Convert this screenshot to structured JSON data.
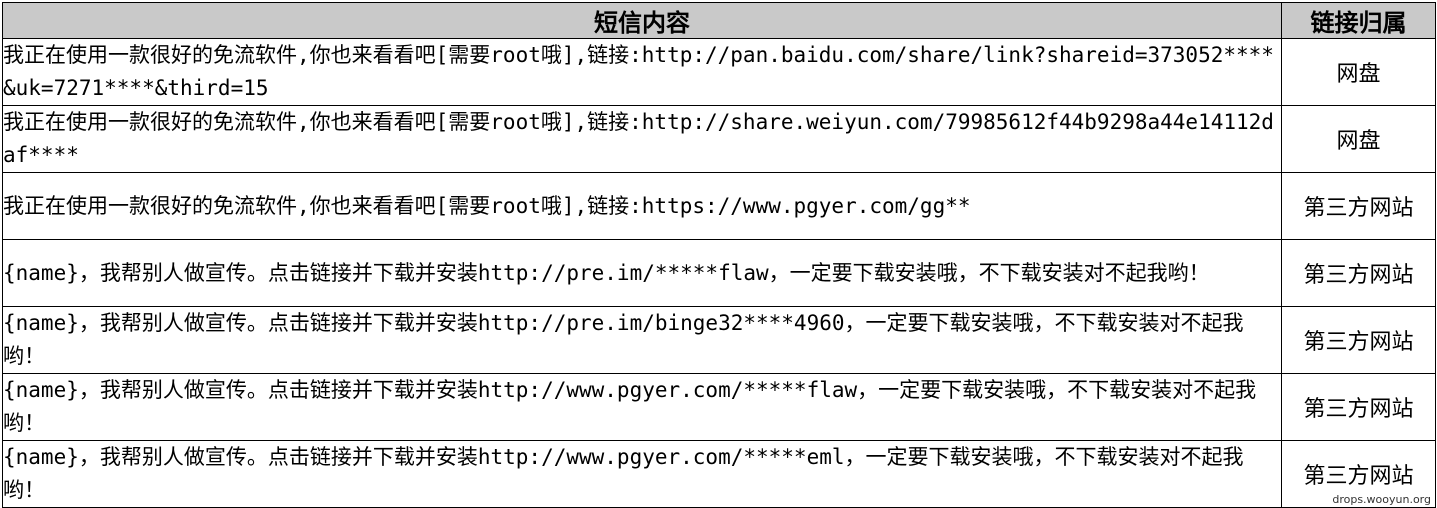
{
  "table": {
    "headers": {
      "content": "短信内容",
      "source": "链接归属"
    },
    "rows": [
      {
        "content": "我正在使用一款很好的免流软件,你也来看看吧[需要root哦],链接:http://pan.baidu.com/share/link?shareid=373052****&uk=7271****&third=15",
        "source": "网盘"
      },
      {
        "content": "我正在使用一款很好的免流软件,你也来看看吧[需要root哦],链接:http://share.weiyun.com/79985612f44b9298a44e14112daf****",
        "source": "网盘"
      },
      {
        "content": "我正在使用一款很好的免流软件,你也来看看吧[需要root哦],链接:https://www.pgyer.com/gg**",
        "source": "第三方网站"
      },
      {
        "content": "{name}，我帮别人做宣传。点击链接并下载并安装http://pre.im/*****flaw，一定要下载安装哦，不下载安装对不起我哟！",
        "source": "第三方网站"
      },
      {
        "content": "{name}，我帮别人做宣传。点击链接并下载并安装http://pre.im/binge32****4960，一定要下载安装哦，不下载安装对不起我哟！",
        "source": "第三方网站"
      },
      {
        "content": "{name}，我帮别人做宣传。点击链接并下载并安装http://www.pgyer.com/*****flaw，一定要下载安装哦，不下载安装对不起我哟！",
        "source": "第三方网站"
      },
      {
        "content": "{name}，我帮别人做宣传。点击链接并下载并安装http://www.pgyer.com/*****eml，一定要下载安装哦，不下载安装对不起我哟！",
        "source": "第三方网站"
      }
    ]
  },
  "watermark": "drops.wooyun.org"
}
